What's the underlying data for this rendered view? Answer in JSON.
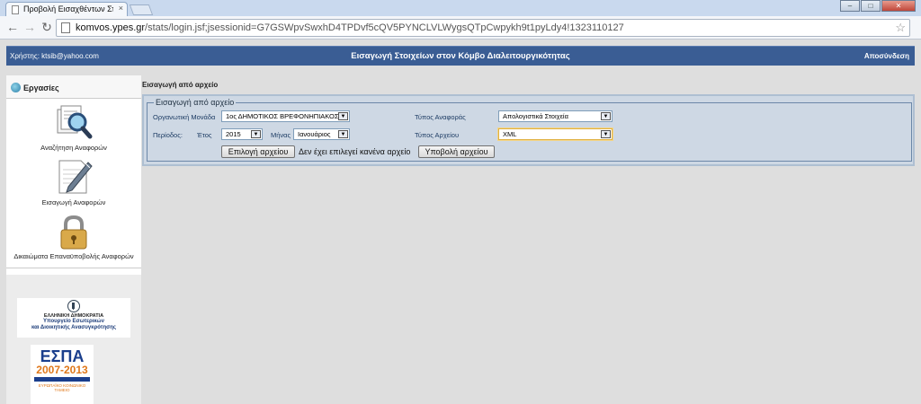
{
  "browser": {
    "tab_title": "Προβολή Εισαχθέντων Στ",
    "tab_close": "×",
    "url_host": "komvos.ypes.gr",
    "url_path": "/stats/login.jsf;jsessionid=G7GSWpvSwxhD4TPDvf5cQV5PYNCLVLWygsQTpCwpykh9t1pyLdy4!1323110127",
    "back": "←",
    "forward": "→",
    "reload": "↻",
    "star": "☆",
    "min": "‒",
    "max": "□",
    "close": "✕"
  },
  "header": {
    "user": "Χρήστης: ktsib@yahoo.com",
    "title": "Εισαγωγή Στοιχείων στον Κόμβο Διαλειτουργικότητας",
    "logout": "Αποσύνδεση"
  },
  "sidebar": {
    "heading": "Εργασίες",
    "items": [
      {
        "label": "Αναζήτηση Αναφορών",
        "icon": "search-reports-icon"
      },
      {
        "label": "Εισαγωγή Αναφορών",
        "icon": "pen-paper-icon"
      },
      {
        "label": "Δικαιώματα Επαναϋποβολής Αναφορών",
        "icon": "padlock-icon"
      }
    ],
    "logo_gr": {
      "line1": "ΕΛΛΗΝΙΚΗ ΔΗΜΟΚΡΑΤΙΑ",
      "line2": "Υπουργείο Εσωτερικών",
      "line3": "και Διοικητικής Ανασυγκρότησης"
    },
    "logo_espa": {
      "word": "ΕΣΠΑ",
      "years": "2007-2013",
      "sub": "ΕΥΡΩΠΑΪΚΟ ΚΟΙΝΩΝΙΚΟ ΤΑΜΕΙΟ"
    }
  },
  "main": {
    "breadcrumb": "Εισαγωγή από αρχείο",
    "legend": "Εισαγωγή από αρχείο",
    "org_label": "Οργανωτική Μονάδα",
    "org_value": "1ος ΔΗΜΟΤΙΚΟΣ ΒΡΕΦΟΝΗΠΙΑΚΟΣ",
    "period_label": "Περίοδος:",
    "year_label": "Έτος",
    "year_value": "2015",
    "month_label": "Μήνας",
    "month_value": "Ιανουάριος",
    "report_type_label": "Τύπος Αναφοράς",
    "report_type_value": "Απολογιστικά Στοιχεία",
    "file_type_label": "Τύπος Αρχείου",
    "file_type_value": "XML",
    "choose_file_button": "Επιλογή αρχείου",
    "no_file_text": "Δεν έχει επιλεγεί κανένα αρχείο",
    "submit_button": "Υποβολή αρχείου",
    "dropdown_arrow": "▼"
  }
}
